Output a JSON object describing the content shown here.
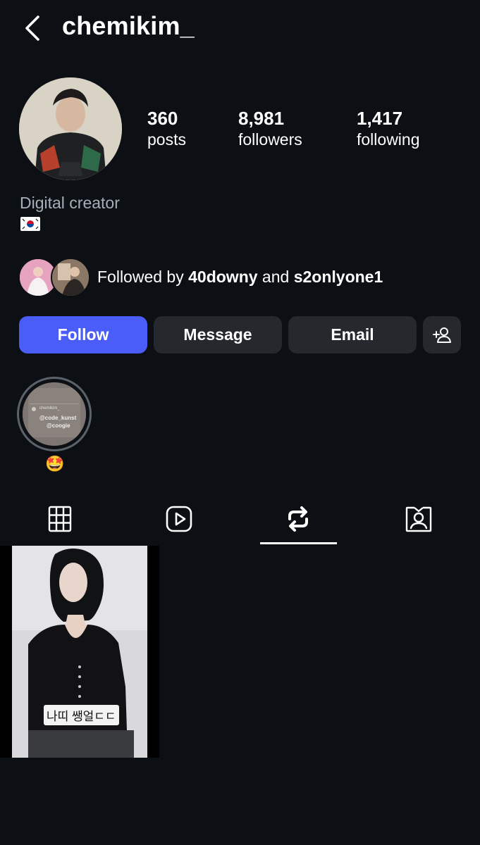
{
  "header": {
    "username": "chemikim_",
    "back_icon": "chevron-left-icon"
  },
  "profile": {
    "stats": [
      {
        "value": "360",
        "label": "posts"
      },
      {
        "value": "8,981",
        "label": "followers"
      },
      {
        "value": "1,417",
        "label": "following"
      }
    ],
    "category": "Digital creator",
    "bio_flag": "south-korea-flag"
  },
  "mutual": {
    "prefix": "Followed by ",
    "user1": "40downy",
    "conjunction": " and ",
    "user2": "s2onlyone1"
  },
  "actions": {
    "follow_label": "Follow",
    "message_label": "Message",
    "email_label": "Email",
    "add_user_icon": "add-user-icon"
  },
  "highlights": [
    {
      "label": "🤩",
      "cover_text_1": "@code_kunst",
      "cover_text_2": "@coogie",
      "cover_small": "chemikim_"
    }
  ],
  "tabs": [
    {
      "name": "grid-icon",
      "active": false
    },
    {
      "name": "reels-icon",
      "active": false
    },
    {
      "name": "reposts-icon",
      "active": true
    },
    {
      "name": "tagged-icon",
      "active": false
    }
  ],
  "posts": [
    {
      "caption": "나띠 쌩얼ㄷㄷ"
    }
  ],
  "colors": {
    "background": "#0c1014",
    "follow_button": "#4a5df9",
    "secondary_button": "#25292e",
    "muted_text": "#a8aeb8"
  }
}
